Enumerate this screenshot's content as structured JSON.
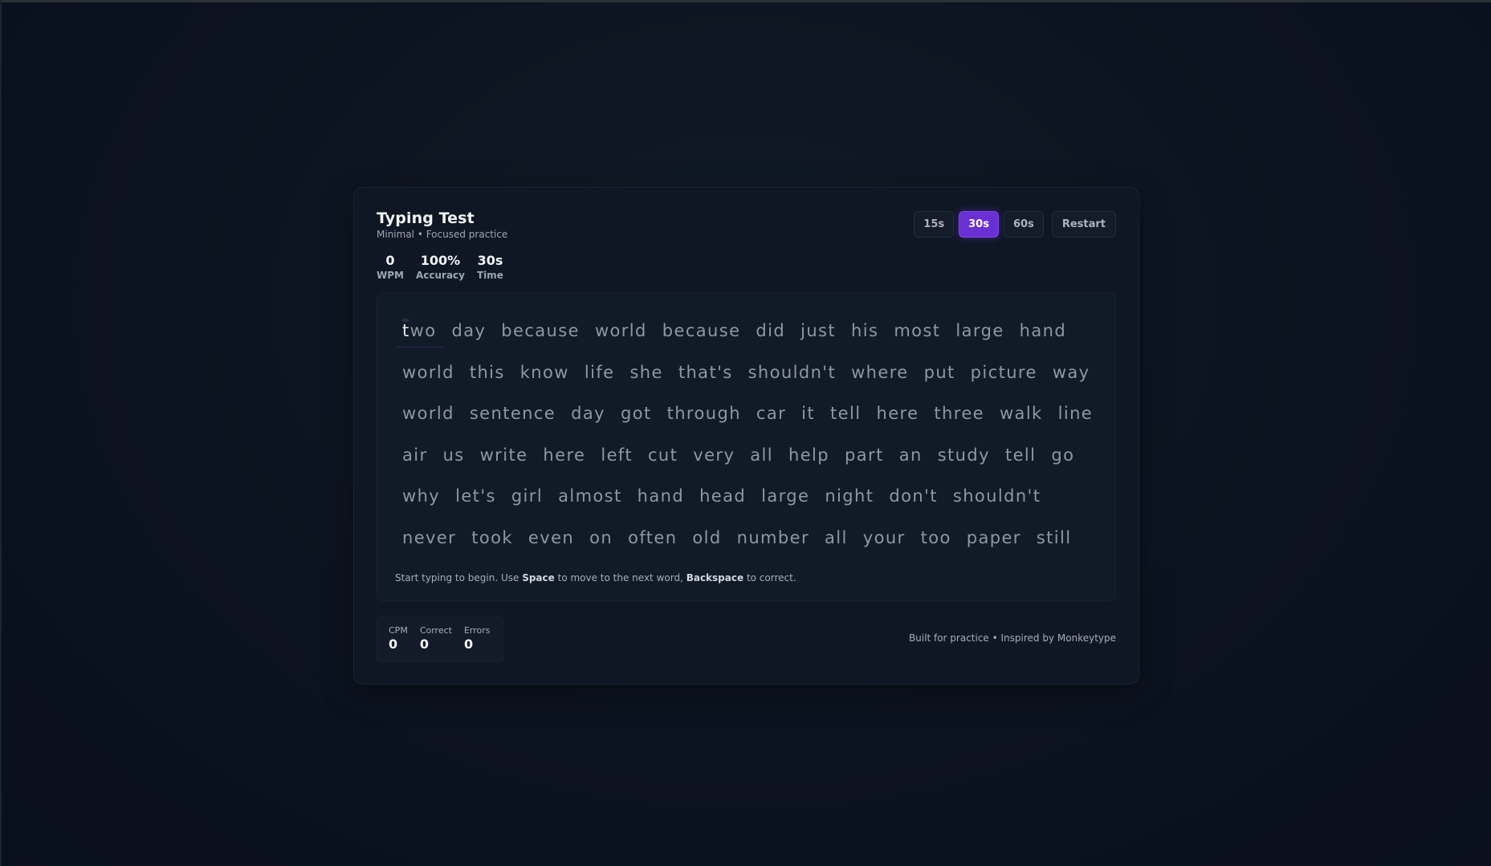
{
  "app": {
    "title": "Typing Test",
    "subtitle": "Minimal • Focused practice"
  },
  "stats": [
    {
      "value": "0",
      "label": "WPM"
    },
    {
      "value": "100%",
      "label": "Accuracy"
    },
    {
      "value": "30s",
      "label": "Time"
    }
  ],
  "controls": {
    "durations": [
      {
        "label": "15s",
        "active": false
      },
      {
        "label": "30s",
        "active": true
      },
      {
        "label": "60s",
        "active": false
      }
    ],
    "restart_label": "Restart",
    "accent_color": "#6b2fd6"
  },
  "words": {
    "current_word_index": 0,
    "current_typed_chars": 1,
    "lines": [
      [
        "two",
        "day",
        "because",
        "world",
        "because",
        "did",
        "just",
        "his",
        "most",
        "large",
        "hand"
      ],
      [
        "world",
        "this",
        "know",
        "life",
        "she",
        "that's",
        "shouldn't",
        "where",
        "put",
        "picture",
        "way"
      ],
      [
        "world",
        "sentence",
        "day",
        "got",
        "through",
        "car",
        "it",
        "tell",
        "here",
        "three",
        "walk",
        "line"
      ],
      [
        "air",
        "us",
        "write",
        "here",
        "left",
        "cut",
        "very",
        "all",
        "help",
        "part",
        "an",
        "study",
        "tell",
        "go"
      ],
      [
        "why",
        "let's",
        "girl",
        "almost",
        "hand",
        "head",
        "large",
        "night",
        "don't",
        "shouldn't"
      ],
      [
        "never",
        "took",
        "even",
        "on",
        "often",
        "old",
        "number",
        "all",
        "your",
        "too",
        "paper",
        "still"
      ]
    ]
  },
  "hint": {
    "part1": "Start typing to begin. Use ",
    "key1": "Space",
    "part2": " to move to the next word, ",
    "key2": "Backspace",
    "part3": " to correct."
  },
  "footer": {
    "stats": [
      {
        "label": "CPM",
        "value": "0"
      },
      {
        "label": "Correct",
        "value": "0"
      },
      {
        "label": "Errors",
        "value": "0"
      }
    ],
    "credit": "Built for practice • Inspired by Monkeytype"
  }
}
